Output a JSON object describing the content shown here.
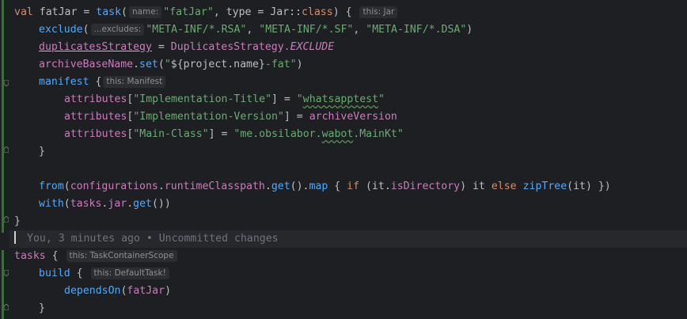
{
  "code": {
    "l1": {
      "kw": "val",
      "name": "fatJar",
      "eq": " = ",
      "fn": "task",
      "paren": "(",
      "hint_name": "name:",
      "str": "\"fatJar\"",
      "mid": ", type = Jar::",
      "kw2": "class",
      "close": ") {",
      "hint_this": "this: Jar"
    },
    "l2": {
      "fn": "exclude",
      "paren": "(",
      "hint": "...excludes:",
      "s1": "\"META-INF/*.RSA\"",
      "c1": ", ",
      "s2": "\"META-INF/*.SF\"",
      "c2": ", ",
      "s3": "\"META-INF/*.DSA\"",
      "close": ")"
    },
    "l3": {
      "prop": "duplicatesStrategy",
      "eq": " = ",
      "cls": "DuplicatesStrategy.",
      "const": "EXCLUDE"
    },
    "l4": {
      "prop": "archiveBaseName",
      "dot": ".",
      "fn": "set",
      "open": "(",
      "q1": "\"",
      "tpl": "${project.name}",
      "s": "-fat\"",
      "close": ")"
    },
    "l5": {
      "fn": "manifest",
      "brace": " {",
      "hint": "this: Manifest"
    },
    "l6": {
      "prop": "attributes",
      "open": "[",
      "key": "\"Implementation-Title\"",
      "mid": "] = ",
      "q1": "\"",
      "val": "whatsapptest",
      "q2": "\""
    },
    "l7": {
      "prop": "attributes",
      "open": "[",
      "key": "\"Implementation-Version\"",
      "mid": "] = ",
      "ident": "archiveVersion"
    },
    "l8": {
      "prop": "attributes",
      "open": "[",
      "key": "\"Main-Class\"",
      "mid": "] = ",
      "a": "\"me.obsilabor.",
      "b": "wabot",
      "c": ".MainKt\""
    },
    "l9": {
      "text": "}"
    },
    "l11": {
      "fn": "from",
      "p1": "(",
      "prop": "configurations",
      "dot": ".",
      "prop2": "runtimeClasspath",
      "dot2": ".",
      "fn2": "get",
      "p2": "().",
      "fn3": "map",
      "b1": " { ",
      "kw": "if",
      "p3": " (",
      "it": "it",
      "dot3": ".",
      "prop3": "isDirectory",
      "p4": ") ",
      "it2": "it",
      "sp": " ",
      "kw2": "else",
      "sp2": " ",
      "fn4": "zipTree",
      "p5": "(",
      "it3": "it",
      "p6": ") })"
    },
    "l12": {
      "fn": "with",
      "p1": "(",
      "prop": "tasks",
      "dot": ".",
      "prop2": "jar",
      "dot2": ".",
      "fn2": "get",
      "close": "())"
    },
    "l13": {
      "text": "}"
    },
    "blame": "You, 3 minutes ago • Uncommitted changes",
    "l15": {
      "prop": "tasks",
      "brace": " {",
      "hint": "this: TaskContainerScope"
    },
    "l16": {
      "fn": "build",
      "brace": " {",
      "hint": "this: DefaultTask!"
    },
    "l17": {
      "fn": "dependsOn",
      "open": "(",
      "ident": "fatJar",
      "close": ")"
    },
    "l18": {
      "text": "}"
    }
  },
  "colors": {
    "background": "#1e1f22",
    "keyword": "#cf8e6d",
    "function": "#56a8f5",
    "string": "#6aab73",
    "property": "#c77dbb",
    "text": "#bcbec4"
  }
}
